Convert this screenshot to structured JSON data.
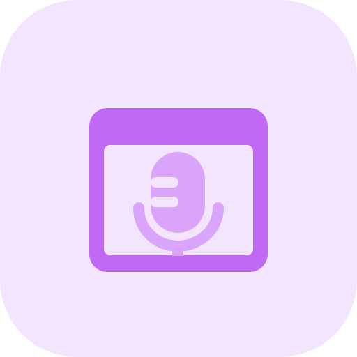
{
  "icon": {
    "name": "browser-microphone-icon",
    "description_name": "voice-search-in-browser",
    "colors": {
      "background": "#F3E5FD",
      "window": "#C069F5",
      "window_content": "#F3E5FD",
      "microphone": "#D9A4FA",
      "microphone_cut": "#F3E5FD"
    }
  }
}
